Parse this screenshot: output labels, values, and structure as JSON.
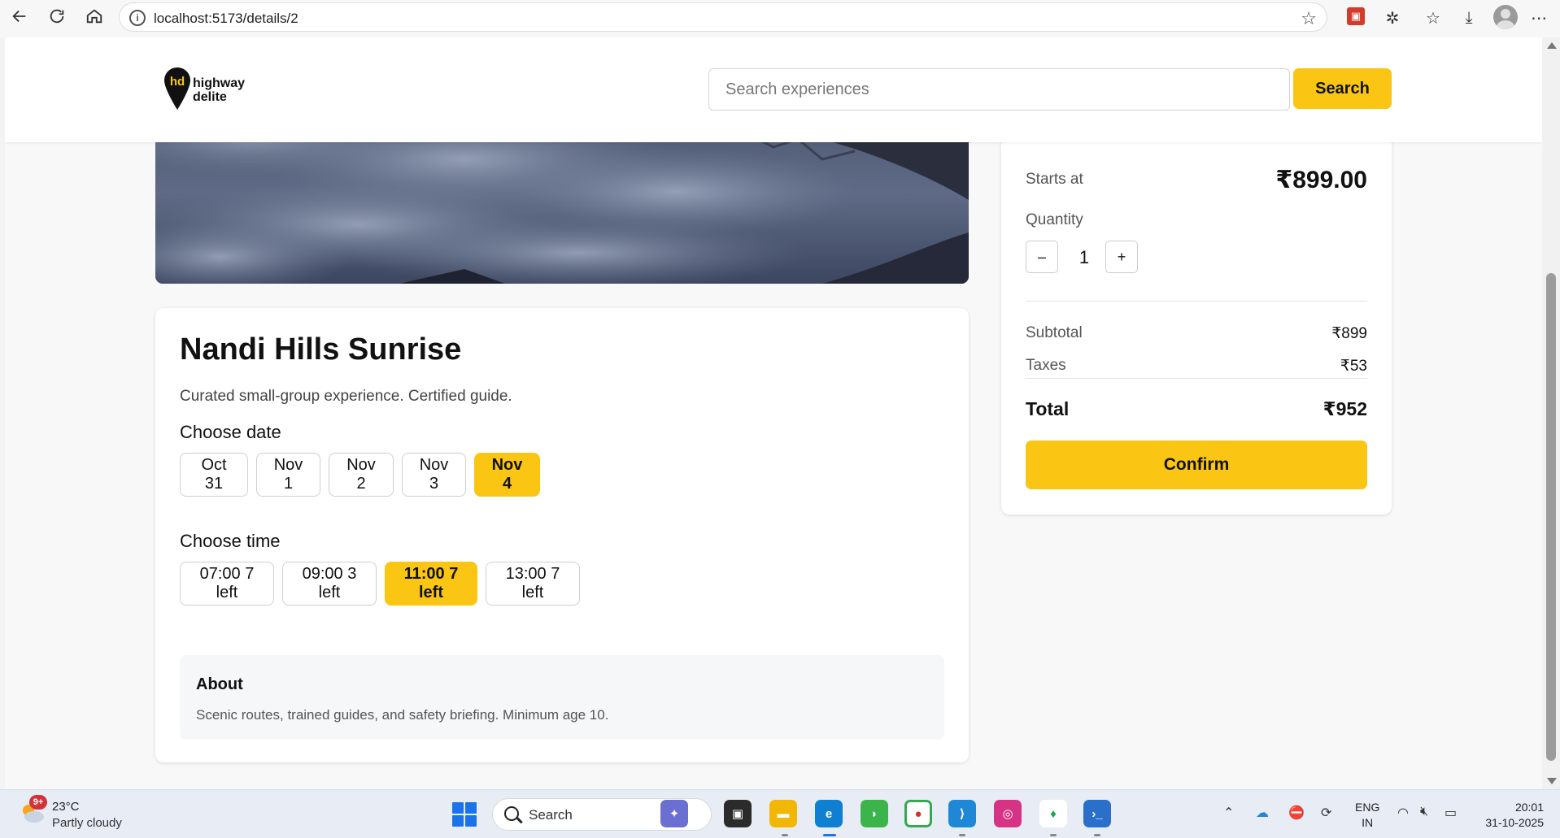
{
  "browser": {
    "url": "localhost:5173/details/2"
  },
  "header": {
    "logo_line1": "highway",
    "logo_line2": "delite",
    "search_placeholder": "Search experiences",
    "search_button": "Search"
  },
  "experience": {
    "title": "Nandi Hills Sunrise",
    "subtitle": "Curated small-group experience. Certified guide.",
    "choose_date_label": "Choose date",
    "dates": [
      "Oct 31",
      "Nov 1",
      "Nov 2",
      "Nov 3",
      "Nov 4"
    ],
    "selected_date": "Nov 4",
    "choose_time_label": "Choose time",
    "times": [
      "07:00 7 left",
      "09:00 3 left",
      "11:00 7 left",
      "13:00 7 left"
    ],
    "selected_time": "11:00 7 left",
    "about_title": "About",
    "about_text": "Scenic routes, trained guides, and safety briefing. Minimum age 10."
  },
  "booking": {
    "starts_at_label": "Starts at",
    "starts_at_value": "₹899.00",
    "quantity_label": "Quantity",
    "minus": "–",
    "quantity": "1",
    "plus": "+",
    "subtotal_label": "Subtotal",
    "subtotal_value": "₹899",
    "taxes_label": "Taxes",
    "taxes_value": "₹53",
    "total_label": "Total",
    "total_value": "₹952",
    "confirm_button": "Confirm"
  },
  "taskbar": {
    "weather_badge": "9+",
    "weather_temp": "23°C",
    "weather_desc": "Partly cloudy",
    "search_label": "Search",
    "lang_line1": "ENG",
    "lang_line2": "IN",
    "time": "20:01",
    "date": "31-10-2025"
  },
  "colors": {
    "accent": "#fac513",
    "card_bg": "#ffffff",
    "about_bg": "#f6f7f9"
  }
}
